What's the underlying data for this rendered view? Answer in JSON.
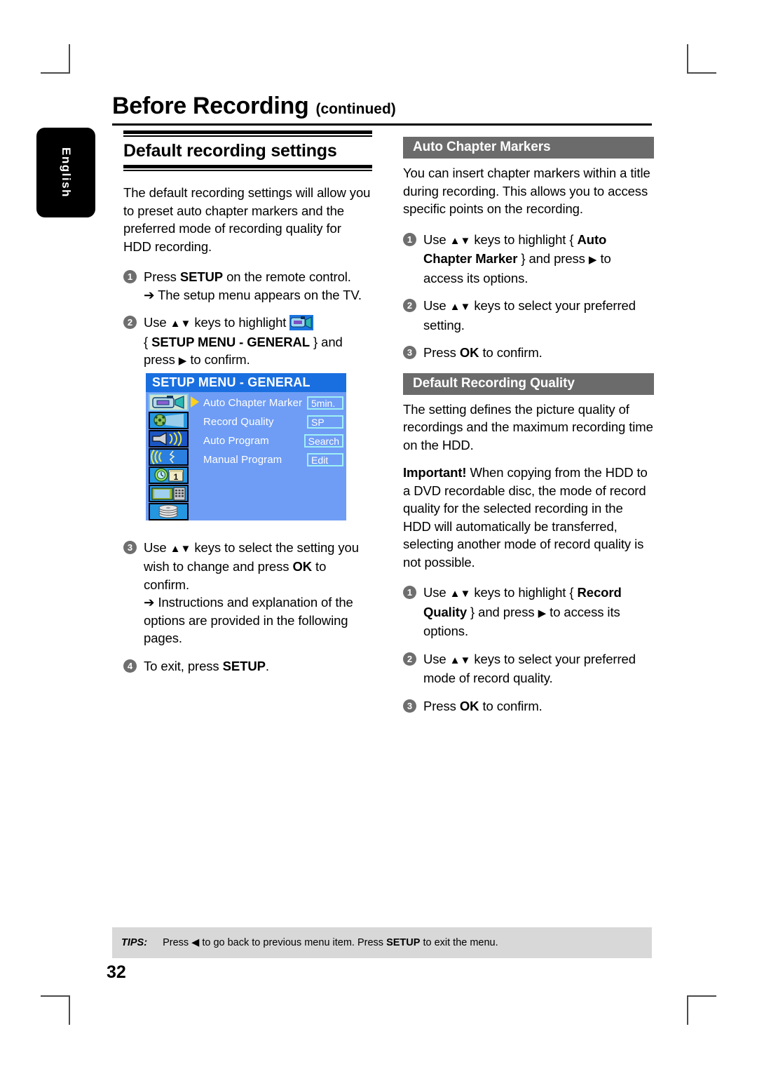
{
  "page": {
    "header_title": "Before Recording",
    "header_continued": "(continued)",
    "language_tab": "English",
    "page_number": "32"
  },
  "left_column": {
    "section_title": "Default recording settings",
    "intro": "The default recording settings will allow you to preset auto chapter markers and the preferred mode of recording quality for HDD recording.",
    "steps": [
      {
        "num": "1",
        "line1_pre": "Press ",
        "line1_bold": "SETUP",
        "line1_post": " on the remote control.",
        "sub": "➔ The setup menu appears on the TV."
      },
      {
        "num": "2",
        "line1_pre": "Use ",
        "line1_keys": "▲▼",
        "line1_mid": " keys to highlight ",
        "line2_pre": "{ ",
        "line2_bold": "SETUP MENU - GENERAL",
        "line2_post": " } and",
        "line3_pre": "press ",
        "line3_key": "▶",
        "line3_post": " to confirm."
      },
      {
        "num": "3",
        "line1_pre": "Use ",
        "line1_keys": "▲▼",
        "line1_mid": " keys to select the setting you wish to change and press ",
        "line1_bold": "OK",
        "line1_post": " to confirm.",
        "sub": "➔ Instructions and explanation of the options are provided in the following pages."
      },
      {
        "num": "4",
        "line1_pre": "To exit, press ",
        "line1_bold": "SETUP",
        "line1_post": "."
      }
    ]
  },
  "tv_menu": {
    "title": "SETUP MENU - GENERAL",
    "rows": [
      {
        "label": "Auto Chapter Marker",
        "value": "5min.",
        "selected": true
      },
      {
        "label": "Record Quality",
        "value": "SP",
        "selected": false
      },
      {
        "label": "Auto Program",
        "value": "Search",
        "selected": false
      },
      {
        "label": "Manual Program",
        "value": "Edit",
        "selected": false
      }
    ],
    "icons": [
      "camcorder-icon",
      "film-reel-icon",
      "speaker-icon",
      "sound-waves-icon",
      "clock-calendar-icon",
      "tv-keypad-icon",
      "disc-stack-icon"
    ],
    "colors": {
      "title_bar": "#1a6fe0",
      "background": "#6f9df5",
      "value_border": "#9ff0f5",
      "caret": "#ffd11a"
    }
  },
  "right_column": {
    "section_1": {
      "band": "Auto Chapter Markers",
      "body": "You can insert chapter markers within a title during recording. This allows you to access specific points on the recording.",
      "steps": [
        {
          "num": "1",
          "pre": "Use ",
          "keys": "▲▼",
          "mid": " keys to highlight { ",
          "bold": "Auto Chapter Marker",
          "post": " } and press ",
          "key2": "▶",
          "tail": " to access its options."
        },
        {
          "num": "2",
          "pre": "Use ",
          "keys": "▲▼",
          "mid": " keys to select your preferred setting."
        },
        {
          "num": "3",
          "pre": "Press ",
          "bold": "OK",
          "post": " to confirm."
        }
      ]
    },
    "section_2": {
      "band": "Default Recording Quality",
      "body": "The setting defines the picture quality of recordings and the maximum recording time on the HDD.",
      "important_bold": "Important!",
      "important_rest": " When copying from the HDD to a DVD recordable disc, the mode of record quality for the selected recording in the HDD will automatically be transferred, selecting another mode of record quality is not possible.",
      "steps": [
        {
          "num": "1",
          "pre": "Use ",
          "keys": "▲▼",
          "mid": " keys to highlight { ",
          "bold": "Record Quality",
          "post": " } and press ",
          "key2": "▶",
          "tail": " to access its options."
        },
        {
          "num": "2",
          "pre": "Use ",
          "keys": "▲▼",
          "mid": " keys to select your preferred mode of record quality."
        },
        {
          "num": "3",
          "pre": "Press ",
          "bold": "OK",
          "post": " to confirm."
        }
      ]
    }
  },
  "tips": {
    "label": "TIPS:",
    "pre": "Press ",
    "key_back": "◀",
    "mid": " to go back to previous menu item. Press ",
    "bold": "SETUP",
    "post": " to exit the menu."
  }
}
